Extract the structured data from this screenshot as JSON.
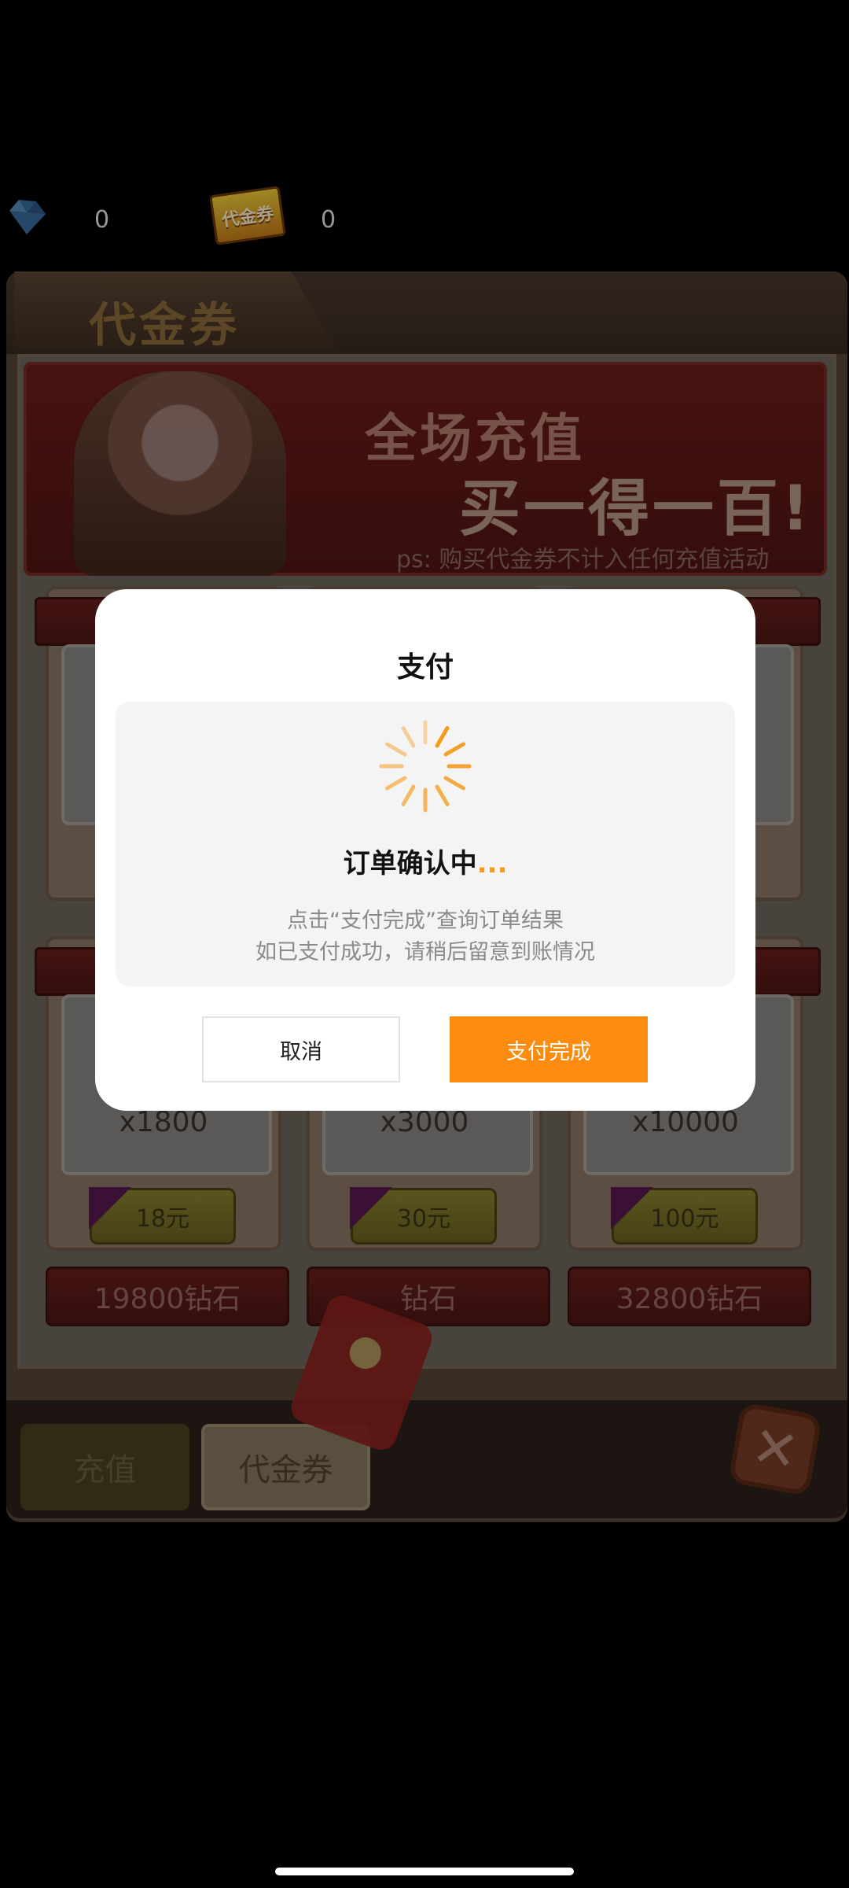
{
  "currency": {
    "gem_count": "0",
    "voucher_badge": "代金券",
    "voucher_count": "0"
  },
  "panel": {
    "title": "代金券",
    "banner": {
      "line1": "全场充值",
      "line2": "买一得一百!",
      "note": "ps: 购买代金券不计入任何充值活动"
    },
    "cards": [
      {
        "amount": "x1800",
        "price": "18元"
      },
      {
        "amount": "x3000",
        "price": "30元"
      },
      {
        "amount": "x10000",
        "price": "100元"
      }
    ],
    "gem_ribbons": [
      "19800钻石",
      "钻石",
      "32800钻石"
    ],
    "tabs": {
      "recharge": "充值",
      "voucher": "代金券"
    }
  },
  "dialog": {
    "title": "支付",
    "status": "订单确认中",
    "status_dots": "...",
    "hint_line1": "点击“支付完成”查询订单结果",
    "hint_line2": "如已支付成功，请稍后留意到账情况",
    "cancel_label": "取消",
    "done_label": "支付完成"
  },
  "colors": {
    "accent": "#fb8c10",
    "spinner": "#f59a1a"
  }
}
